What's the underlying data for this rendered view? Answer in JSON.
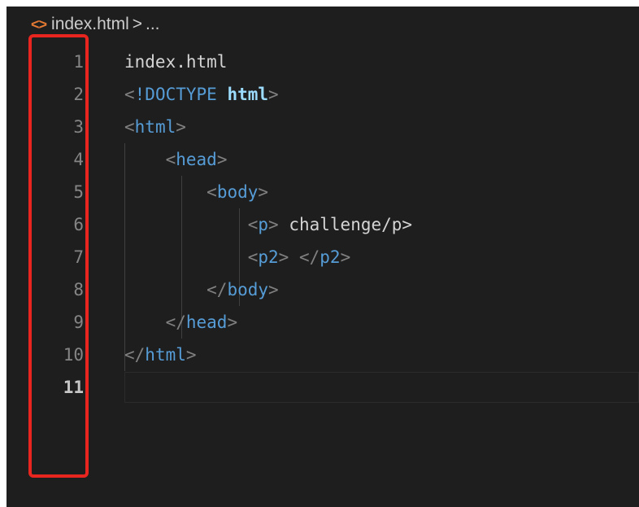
{
  "breadcrumb": {
    "icon": "html-file-icon",
    "file": "index.html",
    "separator": ">",
    "ellipsis": "..."
  },
  "editor": {
    "line_numbers": [
      "1",
      "2",
      "3",
      "4",
      "5",
      "6",
      "7",
      "8",
      "9",
      "10",
      "11"
    ],
    "active_line": "11",
    "lines": [
      [
        {
          "t": "index.html",
          "c": "text"
        }
      ],
      [
        {
          "t": "<",
          "c": "punct"
        },
        {
          "t": "!DOCTYPE",
          "c": "doctype"
        },
        {
          "t": " ",
          "c": "text"
        },
        {
          "t": "html",
          "c": "kw"
        },
        {
          "t": ">",
          "c": "punct"
        }
      ],
      [
        {
          "t": "<",
          "c": "punct"
        },
        {
          "t": "html",
          "c": "tag"
        },
        {
          "t": ">",
          "c": "punct"
        }
      ],
      [
        {
          "t": "    ",
          "c": "text"
        },
        {
          "t": "<",
          "c": "punct"
        },
        {
          "t": "head",
          "c": "tag"
        },
        {
          "t": ">",
          "c": "punct"
        }
      ],
      [
        {
          "t": "        ",
          "c": "text"
        },
        {
          "t": "<",
          "c": "punct"
        },
        {
          "t": "body",
          "c": "tag"
        },
        {
          "t": ">",
          "c": "punct"
        }
      ],
      [
        {
          "t": "            ",
          "c": "text"
        },
        {
          "t": "<",
          "c": "punct"
        },
        {
          "t": "p",
          "c": "tag"
        },
        {
          "t": ">",
          "c": "punct"
        },
        {
          "t": " challenge/p>",
          "c": "text"
        }
      ],
      [
        {
          "t": "            ",
          "c": "text"
        },
        {
          "t": "<",
          "c": "punct"
        },
        {
          "t": "p2",
          "c": "tag"
        },
        {
          "t": ">",
          "c": "punct"
        },
        {
          "t": " ",
          "c": "text"
        },
        {
          "t": "</",
          "c": "punct"
        },
        {
          "t": "p2",
          "c": "tag"
        },
        {
          "t": ">",
          "c": "punct"
        }
      ],
      [
        {
          "t": "        ",
          "c": "text"
        },
        {
          "t": "</",
          "c": "punct"
        },
        {
          "t": "body",
          "c": "tag"
        },
        {
          "t": ">",
          "c": "punct"
        }
      ],
      [
        {
          "t": "    ",
          "c": "text"
        },
        {
          "t": "</",
          "c": "punct"
        },
        {
          "t": "head",
          "c": "tag"
        },
        {
          "t": ">",
          "c": "punct"
        }
      ],
      [
        {
          "t": "</",
          "c": "punct"
        },
        {
          "t": "html",
          "c": "tag"
        },
        {
          "t": ">",
          "c": "punct"
        }
      ],
      []
    ]
  },
  "colors": {
    "editor_bg": "#1e1e1e",
    "highlight_border": "#e8251f",
    "tag": "#569cd6",
    "punctuation": "#808080",
    "text": "#d4d4d4",
    "line_number": "#858585"
  }
}
